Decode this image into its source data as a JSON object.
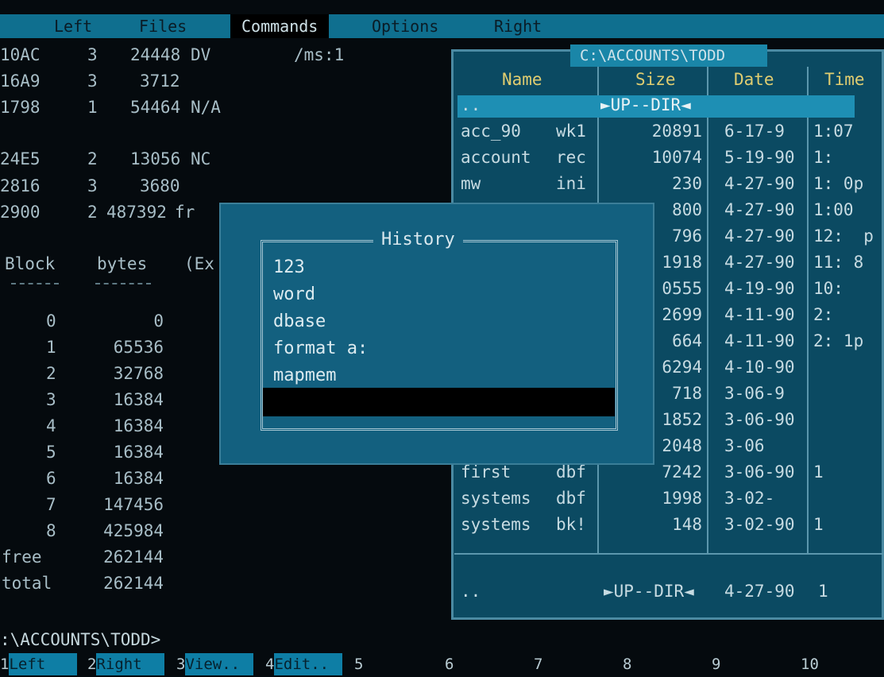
{
  "menu": [
    "Left",
    "Files",
    "Commands",
    "Options",
    "Right"
  ],
  "left_panel": {
    "map_rows": [
      {
        "addr": "10AC",
        "n": "3",
        "size": "24448",
        "extra": "DV",
        "note": "/ms:1"
      },
      {
        "addr": "16A9",
        "n": "3",
        "size": "3712",
        "extra": "",
        "note": ""
      },
      {
        "addr": "1798",
        "n": "1",
        "size": "54464",
        "extra": "N/A",
        "note": ""
      },
      {
        "addr": "24E5",
        "n": "2",
        "size": "13056",
        "extra": "NC",
        "note": ""
      },
      {
        "addr": "2816",
        "n": "3",
        "size": "3680",
        "extra": "",
        "note": ""
      },
      {
        "addr": "2900",
        "n": "2",
        "size": "487392",
        "extra": "fr",
        "note": ""
      }
    ],
    "block_header": {
      "col1": "Block",
      "col2": "bytes",
      "col3": "(Ex"
    },
    "block_rows": [
      {
        "block": "0",
        "bytes": "0"
      },
      {
        "block": "1",
        "bytes": "65536"
      },
      {
        "block": "2",
        "bytes": "32768"
      },
      {
        "block": "3",
        "bytes": "16384"
      },
      {
        "block": "4",
        "bytes": "16384"
      },
      {
        "block": "5",
        "bytes": "16384"
      },
      {
        "block": "6",
        "bytes": "16384"
      },
      {
        "block": "7",
        "bytes": "147456"
      },
      {
        "block": "8",
        "bytes": "425984"
      },
      {
        "block": "free",
        "bytes": "262144"
      },
      {
        "block": "total",
        "bytes": "262144"
      }
    ]
  },
  "right_panel": {
    "title": "C:\\ACCOUNTS\\TODD",
    "columns": [
      "Name",
      "Size",
      "Date",
      "Time"
    ],
    "up_dir": {
      "name": "..",
      "size": "►UP--DIR◄"
    },
    "files": [
      {
        "name": "acc_90",
        "ext": "wk1",
        "size": "20891",
        "date": "6-17-9",
        "time": "1:07"
      },
      {
        "name": "account",
        "ext": "rec",
        "size": "10074",
        "date": "5-19-90",
        "time": "1:"
      },
      {
        "name": "mw",
        "ext": "ini",
        "size": "230",
        "date": "4-27-90",
        "time": "1: 0p"
      },
      {
        "name": "",
        "ext": "",
        "size": "800",
        "date": "4-27-90",
        "time": "1:00"
      },
      {
        "name": "",
        "ext": "",
        "size": "796",
        "date": "4-27-90",
        "time": "12:  p"
      },
      {
        "name": "",
        "ext": "",
        "size": "1918",
        "date": "4-27-90",
        "time": "11: 8"
      },
      {
        "name": "",
        "ext": "",
        "size": "0555",
        "date": "4-19-90",
        "time": "10:"
      },
      {
        "name": "",
        "ext": "",
        "size": "2699",
        "date": "4-11-90",
        "time": "2:"
      },
      {
        "name": "",
        "ext": "",
        "size": "664",
        "date": "4-11-90",
        "time": "2: 1p"
      },
      {
        "name": "",
        "ext": "",
        "size": "6294",
        "date": "4-10-90",
        "time": ""
      },
      {
        "name": "",
        "ext": "",
        "size": "718",
        "date": "3-06-9",
        "time": ""
      },
      {
        "name": "",
        "ext": "",
        "size": "1852",
        "date": "3-06-90",
        "time": ""
      },
      {
        "name": "",
        "ext": "",
        "size": "2048",
        "date": "3-06",
        "time": ""
      },
      {
        "name": "first",
        "ext": "dbf",
        "size": "7242",
        "date": "3-06-90",
        "time": "1"
      },
      {
        "name": "systems",
        "ext": "dbf",
        "size": "1998",
        "date": "3-02-",
        "time": ""
      },
      {
        "name": "systems",
        "ext": "bk!",
        "size": "148",
        "date": "3-02-90",
        "time": "1"
      }
    ],
    "status": {
      "name": "..",
      "size": "►UP--DIR◄",
      "date": "4-27-90",
      "time": "1"
    }
  },
  "history": {
    "title": "History",
    "items": [
      "123",
      "word",
      "dbase",
      "format a:",
      "mapmem"
    ],
    "input_value": ""
  },
  "command_line": ":\\ACCOUNTS\\TODD>",
  "fkeys": [
    {
      "num": "1",
      "label": "Left"
    },
    {
      "num": "2",
      "label": "Right"
    },
    {
      "num": "3",
      "label": "View.."
    },
    {
      "num": "4",
      "label": "Edit.."
    },
    {
      "num": "5",
      "label": ""
    },
    {
      "num": "6",
      "label": ""
    },
    {
      "num": "7",
      "label": ""
    },
    {
      "num": "8",
      "label": ""
    },
    {
      "num": "9",
      "label": ""
    },
    {
      "num": "10",
      "label": ""
    }
  ]
}
